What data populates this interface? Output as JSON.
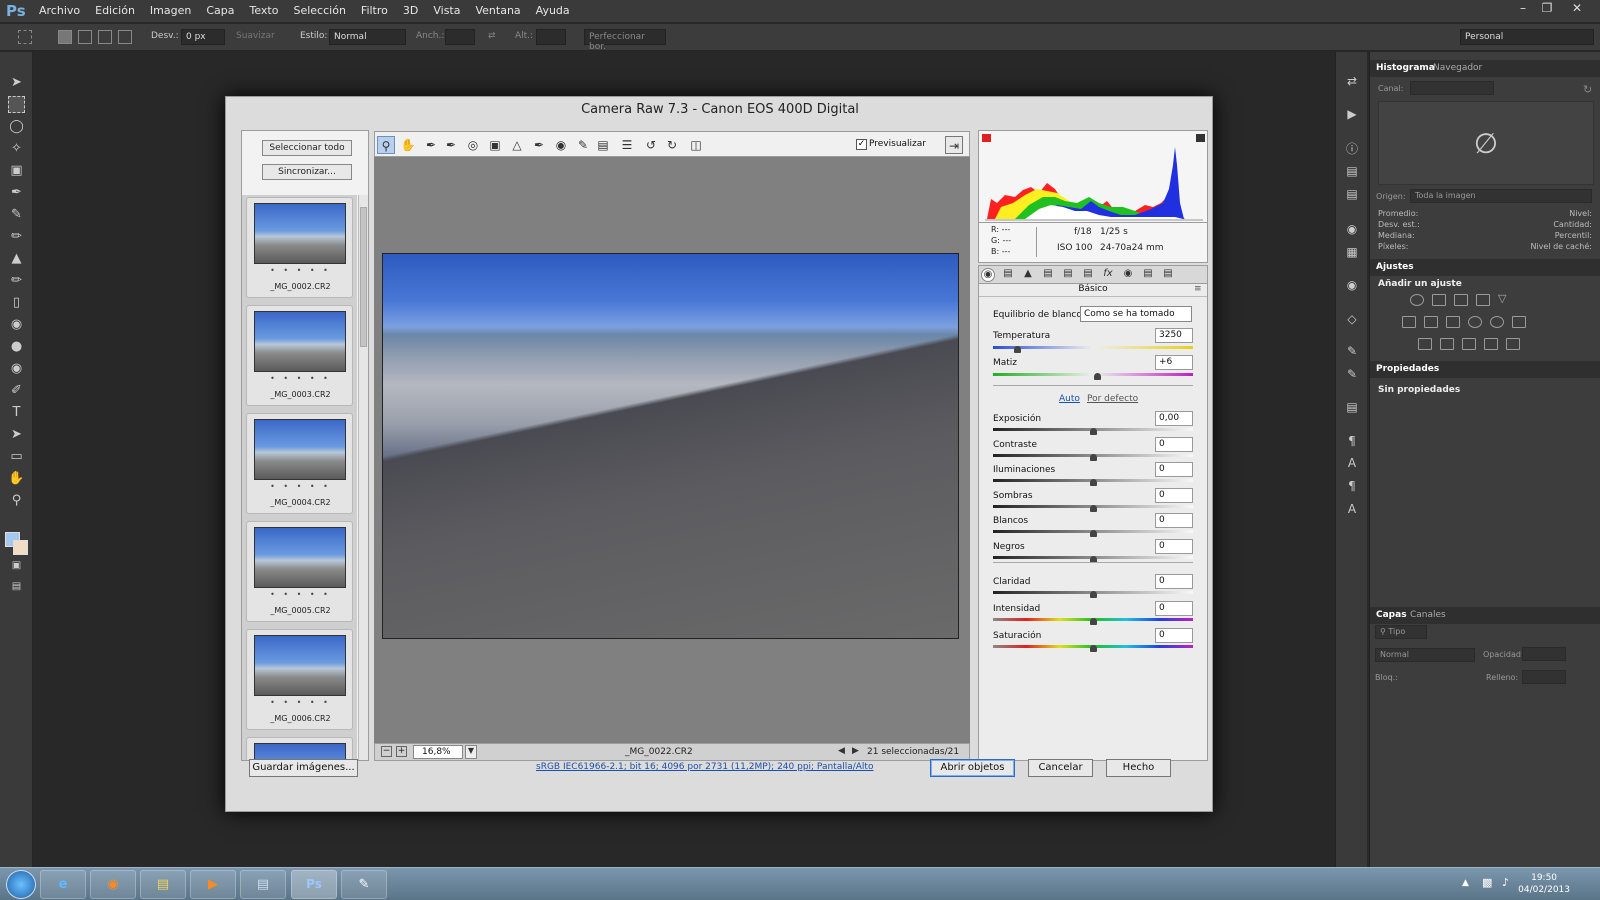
{
  "app": {
    "logo": "Ps",
    "menu": [
      "Archivo",
      "Edición",
      "Imagen",
      "Capa",
      "Texto",
      "Selección",
      "Filtro",
      "3D",
      "Vista",
      "Ventana",
      "Ayuda"
    ],
    "workspace": "Personal"
  },
  "options": {
    "desv_label": "Desv.:",
    "desv_value": "0 px",
    "suavizar": "Suavizar",
    "estilo_label": "Estilo:",
    "estilo_value": "Normal",
    "anch_label": "Anch.:",
    "alt_label": "Alt.:",
    "perfeccionar": "Perfeccionar bor."
  },
  "dialog": {
    "title": "Camera Raw 7.3 -  Canon EOS 400D Digital",
    "select_all": "Seleccionar todo",
    "sync": "Sincronizar...",
    "thumbs": [
      {
        "name": "_MG_0002.CR2",
        "dots": "• • • • •"
      },
      {
        "name": "_MG_0003.CR2",
        "dots": "• • • • •"
      },
      {
        "name": "_MG_0004.CR2",
        "dots": "• • • • •"
      },
      {
        "name": "_MG_0005.CR2",
        "dots": "• • • • •"
      },
      {
        "name": "_MG_0006.CR2",
        "dots": "• • • • •"
      }
    ],
    "preview_label": "Previsualizar",
    "zoom": "16,8%",
    "filename": "_MG_0022.CR2",
    "selected": "21 seleccionadas/21",
    "histo": {
      "r": "R:  ---",
      "g": "G:  ---",
      "b": "B:  ---",
      "aperture": "f/18",
      "shutter": "1/25 s",
      "iso": "ISO 100",
      "lens": "24-70a24 mm"
    },
    "panel_title": "Básico",
    "wb_label": "Equilibrio de blancos:",
    "wb_value": "Como se ha tomado",
    "temp_label": "Temperatura",
    "temp_value": "3250",
    "temp_pos": 0.12,
    "tint_label": "Matiz",
    "tint_value": "+6",
    "tint_pos": 0.52,
    "auto": "Auto",
    "default": "Por defecto",
    "sliders1": [
      {
        "label": "Exposición",
        "value": "0,00",
        "pos": 0.5
      },
      {
        "label": "Contraste",
        "value": "0",
        "pos": 0.5
      },
      {
        "label": "Iluminaciones",
        "value": "0",
        "pos": 0.5
      },
      {
        "label": "Sombras",
        "value": "0",
        "pos": 0.5
      },
      {
        "label": "Blancos",
        "value": "0",
        "pos": 0.5
      },
      {
        "label": "Negros",
        "value": "0",
        "pos": 0.5
      }
    ],
    "sliders2": [
      {
        "label": "Claridad",
        "value": "0",
        "pos": 0.5
      },
      {
        "label": "Intensidad",
        "value": "0",
        "pos": 0.5
      },
      {
        "label": "Saturación",
        "value": "0",
        "pos": 0.5
      }
    ],
    "save": "Guardar imágenes...",
    "info_link": "sRGB IEC61966-2.1; bit 16; 4096 por 2731 (11,2MP); 240 ppi; Pantalla/Alto",
    "open": "Abrir objetos",
    "cancel": "Cancelar",
    "done": "Hecho"
  },
  "panels": {
    "histogram_tab": "Histograma",
    "navigator_tab": "Navegador",
    "canal": "Canal:",
    "origen": "Origen:",
    "origen_value": "Toda la imagen",
    "stats_left": [
      "Promedio:",
      "Desv. est.:",
      "Mediana:",
      "Píxeles:"
    ],
    "stats_right": [
      "Nivel:",
      "Cantidad:",
      "Percentil:",
      "Nivel de caché:"
    ],
    "ajustes_tab": "Ajustes",
    "add_adjust": "Añadir un ajuste",
    "propiedades_tab": "Propiedades",
    "sin_prop": "Sin propiedades",
    "capas_tab": "Capas",
    "canales_tab": "Canales",
    "tipo": "Tipo",
    "blend": "Normal",
    "opacidad": "Opacidad:",
    "bloq": "Bloq.:",
    "relleno": "Relleno:"
  },
  "taskbar": {
    "time": "19:50",
    "date": "04/02/2013"
  },
  "colors": {
    "accent": "#1d4fa8",
    "bg": "#282828",
    "dialog": "#dcdcdc"
  }
}
